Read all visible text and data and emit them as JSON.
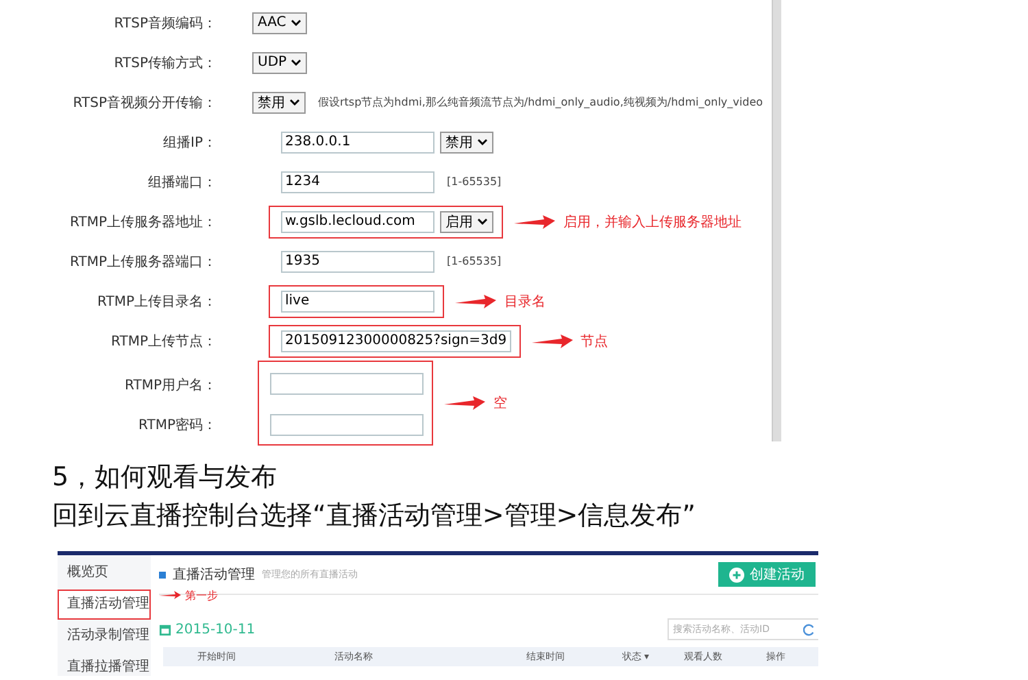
{
  "settings_screenshot": {
    "rows": [
      {
        "label": "RTSP音频编码：",
        "kind": "select",
        "value": "AAC",
        "highlighted": false
      },
      {
        "label": "RTSP传输方式：",
        "kind": "select",
        "value": "UDP",
        "highlighted": false
      },
      {
        "label": "RTSP音视频分开传输：",
        "kind": "select",
        "value": "禁用",
        "highlighted": false,
        "hint": "假设rtsp节点为hdmi,那么纯音频流节点为/hdmi_only_audio,纯视频为/hdmi_only_video"
      },
      {
        "label": "组播IP：",
        "kind": "input",
        "value": "238.0.0.1",
        "select": "禁用",
        "highlighted": false
      },
      {
        "label": "组播端口：",
        "kind": "input",
        "value": "1234",
        "hint": "[1-65535]",
        "highlighted": false
      },
      {
        "label": "RTMP上传服务器地址：",
        "kind": "input",
        "value": "w.gslb.lecloud.com",
        "select": "启用",
        "highlighted": true,
        "annotation": "启用，并输入上传服务器地址"
      },
      {
        "label": "RTMP上传服务器端口：",
        "kind": "input",
        "value": "1935",
        "hint": "[1-65535]",
        "highlighted": false
      },
      {
        "label": "RTMP上传目录名：",
        "kind": "input",
        "value": "live",
        "highlighted": true,
        "annotation": "目录名"
      },
      {
        "label": "RTMP上传节点：",
        "kind": "input",
        "value": "20150912300000825?sign=3d9",
        "highlighted": true,
        "annotation": "节点"
      }
    ],
    "group": {
      "highlighted": true,
      "annotation": "空",
      "rows": [
        {
          "label": "RTMP用户名：",
          "kind": "input"
        },
        {
          "label": "RTMP密码：",
          "kind": "input"
        }
      ]
    }
  },
  "heading": "5，如何观看与发布",
  "instruction": "回到云直播控制台选择“直播活动管理>管理>信息发布”",
  "console_screenshot": {
    "sidebar": [
      {
        "label": "概览页",
        "highlighted": false
      },
      {
        "label": "直播活动管理",
        "highlighted": true
      },
      {
        "label": "活动录制管理",
        "highlighted": false
      },
      {
        "label": "直播拉播管理",
        "highlighted": false
      }
    ],
    "step_annotation": "第一步",
    "title": "直播活动管理",
    "subtitle": "管理您的所有直播活动",
    "create_button": "创建活动",
    "date": "2015-10-11",
    "search": {
      "placeholder": "搜索活动名称、活动ID"
    },
    "columns": [
      {
        "label": "开始时间"
      },
      {
        "label": "活动名称"
      },
      {
        "label": "结束时间"
      },
      {
        "label": "状态",
        "sort": "▾"
      },
      {
        "label": "观看人数"
      },
      {
        "label": "操作"
      }
    ]
  }
}
